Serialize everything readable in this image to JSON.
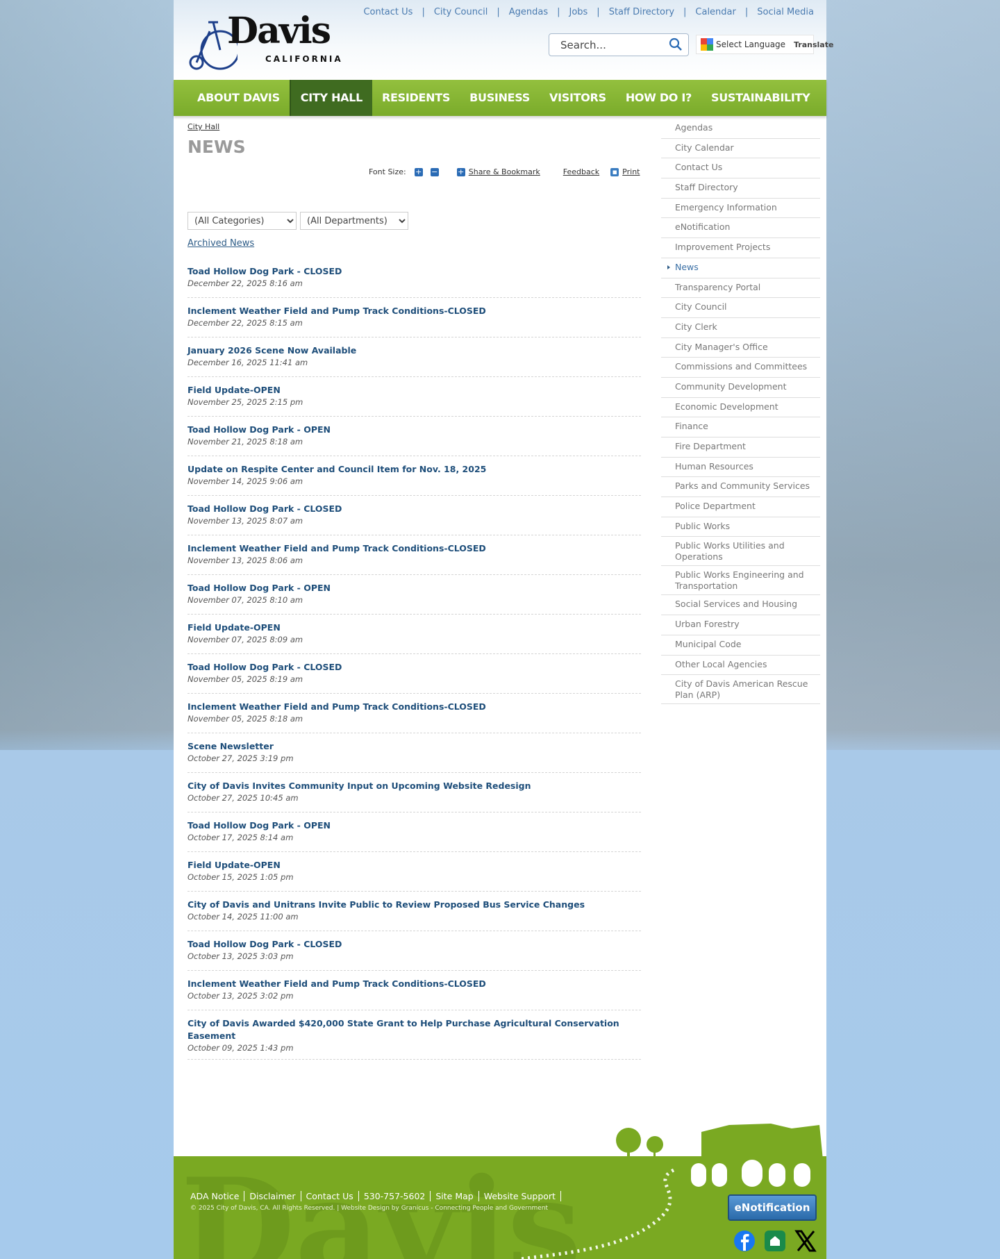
{
  "header": {
    "logo_text": "Davis",
    "logo_sub": "CALIFORNIA",
    "top_links": [
      "Contact Us",
      "City Council",
      "Agendas",
      "Jobs",
      "Staff Directory",
      "Calendar",
      "Social Media"
    ],
    "search_placeholder": "Search...",
    "select_language": "Select Language",
    "translate": "Translate"
  },
  "nav": {
    "items": [
      "ABOUT DAVIS",
      "CITY HALL",
      "RESIDENTS",
      "BUSINESS",
      "VISITORS",
      "HOW DO I?",
      "SUSTAINABILITY"
    ],
    "active": "CITY HALL"
  },
  "page": {
    "breadcrumb": "City Hall",
    "title": "NEWS",
    "font_size_label": "Font Size:",
    "share": "Share & Bookmark",
    "feedback": "Feedback",
    "print": "Print",
    "category_filter": "(All Categories)",
    "department_filter": "(All Departments)",
    "archived": "Archived News"
  },
  "news": [
    {
      "title": "Toad Hollow Dog Park - CLOSED",
      "date": "December 22, 2025 8:16 am"
    },
    {
      "title": "Inclement Weather Field and Pump Track Conditions-CLOSED",
      "date": "December 22, 2025 8:15 am"
    },
    {
      "title": "January 2026 Scene Now Available",
      "date": "December 16, 2025 11:41 am"
    },
    {
      "title": "Field Update-OPEN",
      "date": "November 25, 2025 2:15 pm"
    },
    {
      "title": "Toad Hollow Dog Park - OPEN",
      "date": "November 21, 2025 8:18 am"
    },
    {
      "title": "Update on Respite Center and Council Item for Nov. 18, 2025",
      "date": "November 14, 2025 9:06 am"
    },
    {
      "title": "Toad Hollow Dog Park - CLOSED",
      "date": "November 13, 2025 8:07 am"
    },
    {
      "title": "Inclement Weather Field and Pump Track Conditions-CLOSED",
      "date": "November 13, 2025 8:06 am"
    },
    {
      "title": "Toad Hollow Dog Park - OPEN",
      "date": "November 07, 2025 8:10 am"
    },
    {
      "title": "Field Update-OPEN",
      "date": "November 07, 2025 8:09 am"
    },
    {
      "title": "Toad Hollow Dog Park - CLOSED",
      "date": "November 05, 2025 8:19 am"
    },
    {
      "title": "Inclement Weather Field and Pump Track Conditions-CLOSED",
      "date": "November 05, 2025 8:18 am"
    },
    {
      "title": "Scene Newsletter",
      "date": "October 27, 2025 3:19 pm"
    },
    {
      "title": "City of Davis Invites Community Input on Upcoming Website Redesign",
      "date": "October 27, 2025 10:45 am"
    },
    {
      "title": "Toad Hollow Dog Park - OPEN",
      "date": "October 17, 2025 8:14 am"
    },
    {
      "title": "Field Update-OPEN",
      "date": "October 15, 2025 1:05 pm"
    },
    {
      "title": "City of Davis and Unitrans Invite Public to Review Proposed Bus Service Changes",
      "date": "October 14, 2025 11:00 am"
    },
    {
      "title": "Toad Hollow Dog Park - CLOSED",
      "date": "October 13, 2025 3:03 pm"
    },
    {
      "title": "Inclement Weather Field and Pump Track Conditions-CLOSED",
      "date": "October 13, 2025 3:02 pm"
    },
    {
      "title": "City of Davis Awarded $420,000 State Grant to Help Purchase Agricultural Conservation Easement",
      "date": "October 09, 2025 1:43 pm"
    }
  ],
  "sidebar": {
    "current": "News",
    "items": [
      "Agendas",
      "City Calendar",
      "Contact Us",
      "Staff Directory",
      "Emergency Information",
      "eNotification",
      "Improvement Projects",
      "News",
      "Transparency Portal",
      "City Council",
      "City Clerk",
      "City Manager's Office",
      "Commissions and Committees",
      "Community Development",
      "Economic Development",
      "Finance",
      "Fire Department",
      "Human Resources",
      "Parks and Community Services",
      "Police Department",
      "Public Works",
      "Public Works Utilities and Operations",
      "Public Works Engineering and Transportation",
      "Social Services and Housing",
      "Urban Forestry",
      "Municipal Code",
      "Other Local Agencies",
      "City of Davis American Rescue Plan (ARP)"
    ]
  },
  "footer": {
    "links": [
      "ADA Notice",
      "Disclaimer",
      "Contact Us",
      "530-757-5602",
      "Site Map",
      "Website Support"
    ],
    "copyright": "© 2025 City of Davis, CA. All Rights Reserved. | Website Design by Granicus - Connecting People and Government",
    "enotification": "eNotification",
    "watermark": "Davis"
  },
  "colors": {
    "nav_green": "#7aab2a",
    "active_nav": "#3f6b20",
    "link_blue": "#1e4e7a",
    "footer_green": "#7aa922"
  }
}
